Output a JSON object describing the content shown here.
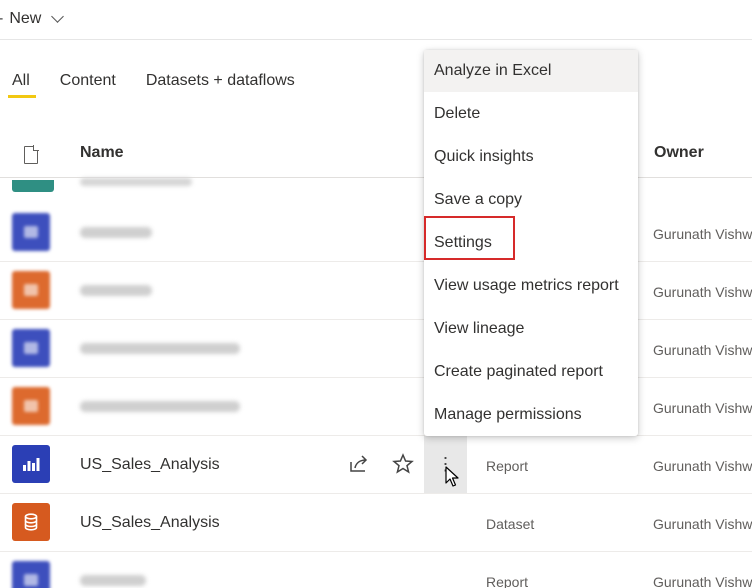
{
  "toolbar": {
    "new_label": "New"
  },
  "tabs": [
    {
      "label": "All",
      "active": true
    },
    {
      "label": "Content",
      "active": false
    },
    {
      "label": "Datasets + dataflows",
      "active": false
    }
  ],
  "table": {
    "columns": {
      "name": "Name",
      "owner": "Owner"
    },
    "rows": [
      {
        "icon": "report-icon",
        "name": "",
        "type": "",
        "owner": "Gurunath Vishw",
        "blurred": true
      },
      {
        "icon": "dataset-icon",
        "name": "",
        "type": "",
        "owner": "Gurunath Vishw",
        "blurred": true
      },
      {
        "icon": "report-icon",
        "name": "",
        "type": "",
        "owner": "Gurunath Vishw",
        "blurred": true
      },
      {
        "icon": "dataset-icon",
        "name": "",
        "type": "",
        "owner": "Gurunath Vishw",
        "blurred": true
      },
      {
        "icon": "report-icon",
        "name": "US_Sales_Analysis",
        "type": "Report",
        "owner": "Gurunath Vishw",
        "blurred": false
      },
      {
        "icon": "dataset-icon",
        "name": "US_Sales_Analysis",
        "type": "Dataset",
        "owner": "Gurunath Vishw",
        "blurred": false
      },
      {
        "icon": "report-icon",
        "name": "",
        "type": "Report",
        "owner": "Gurunath Vishw",
        "blurred": true
      }
    ]
  },
  "context_menu": {
    "items": [
      "Analyze in Excel",
      "Delete",
      "Quick insights",
      "Save a copy",
      "Settings",
      "View usage metrics report",
      "View lineage",
      "Create paginated report",
      "Manage permissions"
    ],
    "hovered": "Analyze in Excel",
    "highlighted": "Settings"
  },
  "colors": {
    "accent_tab": "#f2c811",
    "report_tile": "#2b3fb5",
    "dataset_tile": "#d65a1f",
    "highlight": "#d62a2a"
  }
}
